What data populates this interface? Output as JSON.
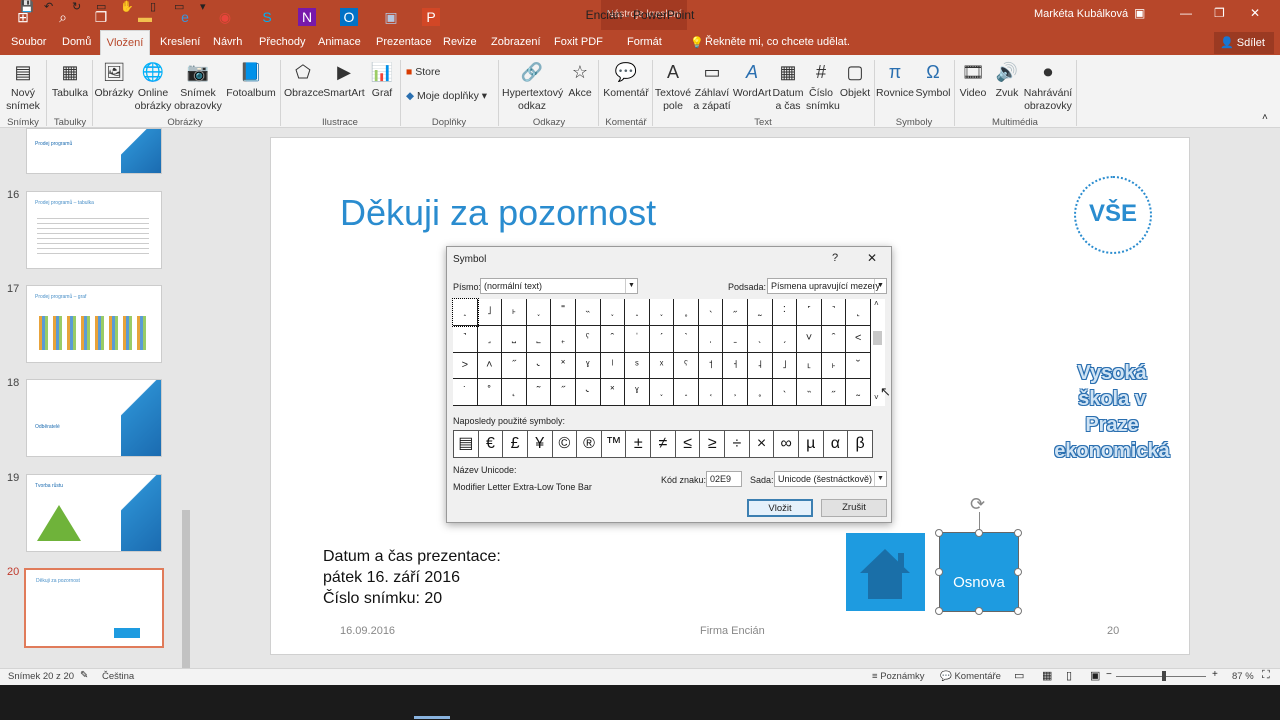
{
  "window": {
    "doc_title": "Encián - PowerPoint",
    "context_group": "Nástroje kreslení",
    "user": "Markéta Kubálková"
  },
  "tabs": [
    "Soubor",
    "Domů",
    "Vložení",
    "Kreslení",
    "Návrh",
    "Přechody",
    "Animace",
    "Prezentace",
    "Revize",
    "Zobrazení",
    "Foxit PDF",
    "Formát"
  ],
  "tellme": "Řekněte mi, co chcete udělat.",
  "share": "Sdílet",
  "ribbon": {
    "novy_snimek": "Nový snímek",
    "tabulka": "Tabulka",
    "obrazky": "Obrázky",
    "online_obrazky": "Online obrázky",
    "snimek_obrazovky": "Snímek obrazovky",
    "fotoalbum": "Fotoalbum",
    "obrazce": "Obrazce",
    "smartart": "SmartArt",
    "graf": "Graf",
    "store": "Store",
    "moje_doplnky": "Moje doplňky",
    "hypertextovy_odkaz": "Hypertextový odkaz",
    "akce": "Akce",
    "komentar": "Komentář",
    "textove_pole": "Textové pole",
    "zahlavi": "Záhlaví a zápatí",
    "wordart": "WordArt",
    "datum_cas": "Datum a čas",
    "cislo_snimku": "Číslo snímku",
    "objekt": "Objekt",
    "rovnice": "Rovnice",
    "symbol": "Symbol",
    "video": "Video",
    "zvuk": "Zvuk",
    "nahravani": "Nahrávání obrazovky",
    "groups": {
      "snimky": "Snímky",
      "tabulky": "Tabulky",
      "obrazky": "Obrázky",
      "ilustrace": "Ilustrace",
      "doplnky": "Doplňky",
      "odkazy": "Odkazy",
      "komentar": "Komentář",
      "text": "Text",
      "symboly": "Symboly",
      "multimedia": "Multimédia"
    }
  },
  "thumbs": [
    {
      "num": "",
      "title": "Prodej programů"
    },
    {
      "num": "16",
      "title": "Prodej programů – tabulka"
    },
    {
      "num": "17",
      "title": "Prodej programů – graf"
    },
    {
      "num": "18",
      "title": "Odběratelé"
    },
    {
      "num": "19",
      "title": "Tvorba růstu"
    },
    {
      "num": "20",
      "title": "Děkuji za pozornost"
    }
  ],
  "slide": {
    "title": "Děkuji za pozornost",
    "info1": "Datum a čas prezentace:",
    "info2": "pátek 16. září 2016",
    "info3": "Číslo snímku: 20",
    "footer_date": "16.09.2016",
    "footer_center": "Firma Encián",
    "footer_num": "20",
    "logo": "VŠE",
    "wordart": "Vysoká škola v Praze ekonomická",
    "osnova": "Osnova"
  },
  "dialog": {
    "title": "Symbol",
    "help": "?",
    "close": "✕",
    "font_label": "Písmo:",
    "font_value": "(normální text)",
    "subset_label": "Podsada:",
    "subset_value": "Písmena upravující mezery",
    "recent_label": "Naposledy použité symboly:",
    "unicode_label": "Název Unicode:",
    "unicode_name": "Modifier Letter Extra-Low Tone Bar",
    "code_label": "Kód znaku:",
    "code_value": "02E9",
    "set_label": "Sada:",
    "set_value": "Unicode (šestnáctkově)",
    "insert": "Vložit",
    "cancel": "Zrušit",
    "grid": [
      "˰",
      "˩",
      "˫",
      "˯",
      "˭",
      "˵",
      "˯",
      "˰",
      "˯",
      "˳",
      "˴",
      "˶",
      "˷",
      "˸",
      "˹",
      "˺",
      "˻",
      "˺",
      "˼",
      "˽",
      "˾",
      "˿",
      "ˁ",
      "ˆ",
      "ˈ",
      "ˊ",
      "ˋ",
      "ˌ",
      "ˍ",
      "ˎ",
      "ˏ",
      "˅",
      "ˆ",
      "˂",
      "˃",
      "˄",
      "˝",
      "˞",
      "˟",
      "ˠ",
      "ˡ",
      "ˢ",
      "ˣ",
      "ˤ",
      "˦",
      "˧",
      "˨",
      "˩",
      "˪",
      "˫",
      "˘",
      "˙",
      "˚",
      "˛",
      "˜",
      "˝",
      "˞",
      "˟",
      "ˠ",
      "˯",
      "˰",
      "˱",
      "˲",
      "˳",
      "˴",
      "˵",
      "˶",
      "˷",
      "˸",
      "˹",
      "˺"
    ],
    "recent": [
      "▤",
      "€",
      "£",
      "¥",
      "©",
      "®",
      "™",
      "±",
      "≠",
      "≤",
      "≥",
      "÷",
      "×",
      "∞",
      "µ",
      "α",
      "β"
    ]
  },
  "status": {
    "slide": "Snímek 20 z 20",
    "lang": "Čeština",
    "notes": "Poznámky",
    "comments": "Komentáře",
    "zoom": "87 %"
  }
}
